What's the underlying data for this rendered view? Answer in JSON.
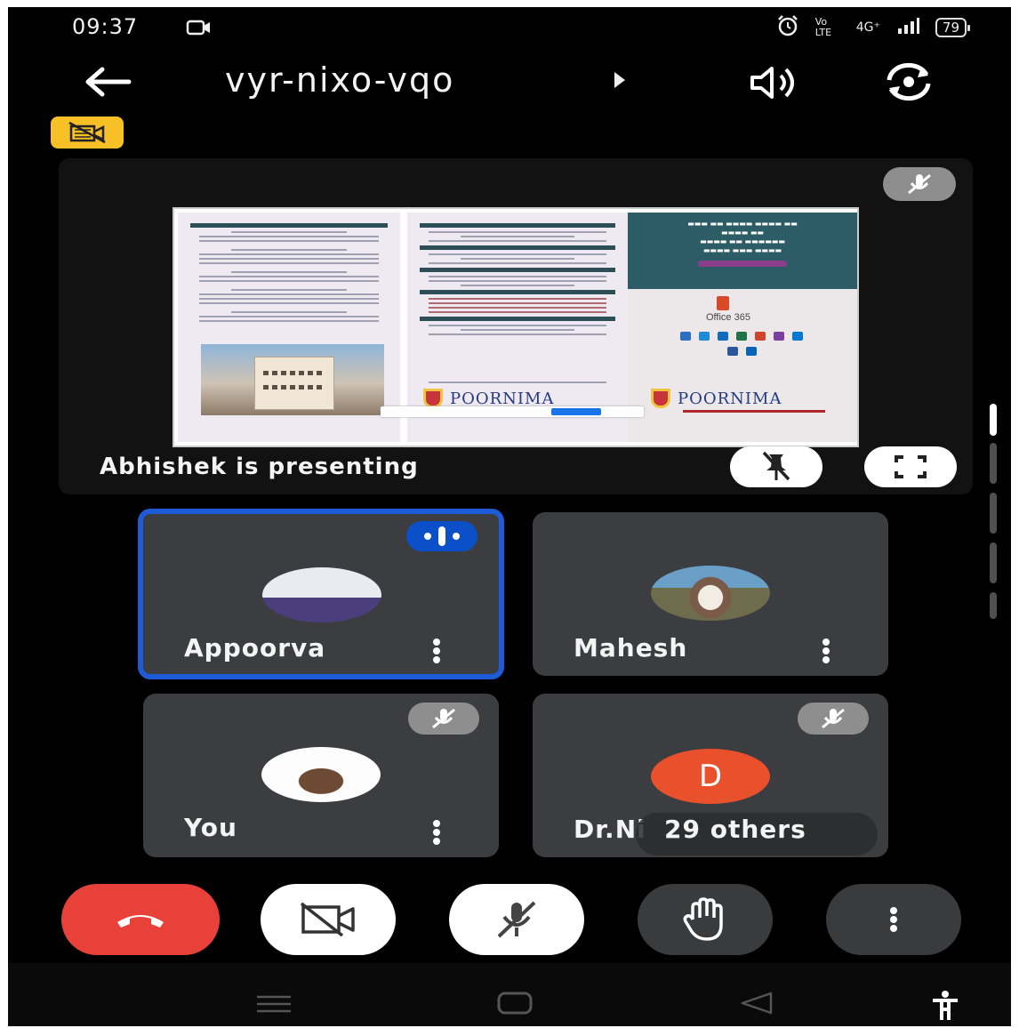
{
  "status_bar": {
    "time": "09:37",
    "network": "4G⁺",
    "volte": "Vo LTE",
    "battery": "79",
    "icons": [
      "screen-record-icon",
      "alarm-icon",
      "signal-icon",
      "battery-icon"
    ]
  },
  "header": {
    "meeting_code": "vyr-nixo-vqo",
    "icons": [
      "back-arrow-icon",
      "meeting-info-arrow-icon",
      "speaker-icon",
      "switch-camera-icon",
      "camera-off-badge-icon"
    ]
  },
  "presentation": {
    "label": "Abhishek is presenting",
    "brochure_brand": "POORNIMA",
    "brochure_brand_2": "POORNIMA",
    "office_text": "Office 365",
    "icons": [
      "mic-off-icon",
      "unpin-icon",
      "fullscreen-icon"
    ]
  },
  "participants": [
    {
      "name": "Appoorva",
      "speaking": true,
      "muted": false
    },
    {
      "name": "Mahesh",
      "speaking": false,
      "muted": false
    },
    {
      "name": "You",
      "speaking": false,
      "muted": true
    },
    {
      "name": "Dr.Ni",
      "initial": "D",
      "others": "29 others",
      "muted": true
    }
  ],
  "controls": {
    "icons": [
      "end-call-icon",
      "camera-off-icon",
      "mic-off-icon",
      "raise-hand-icon",
      "more-options-icon"
    ]
  },
  "nav_bar": {
    "icons": [
      "recents-icon",
      "home-icon",
      "back-icon",
      "accessibility-icon"
    ]
  },
  "colors": {
    "end_call": "#e8413a",
    "speaking_border": "#1e5bd8",
    "avatar_d": "#e8512b",
    "badge_yellow": "#f6c026",
    "tile_bg": "#3c3d40"
  }
}
